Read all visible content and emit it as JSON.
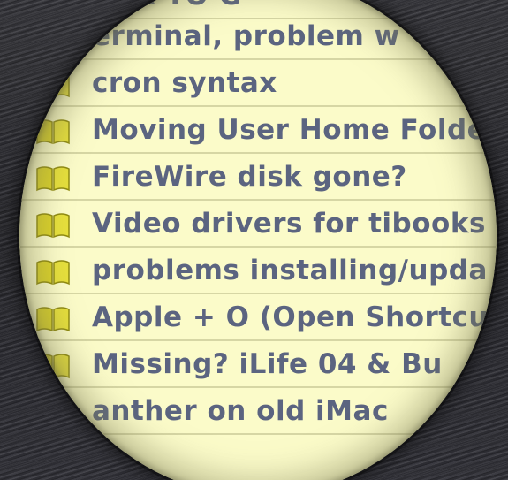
{
  "thread_list": {
    "topics": [
      {
        "title": "HER TO G",
        "icon": "book-icon"
      },
      {
        "title": "erminal, problem w",
        "icon": "book-icon"
      },
      {
        "title": "cron syntax",
        "icon": "book-icon"
      },
      {
        "title": "Moving User Home Folde",
        "icon": "book-icon"
      },
      {
        "title": "FireWire disk gone?",
        "icon": "book-icon"
      },
      {
        "title": "Video drivers for tibooks b",
        "icon": "book-icon"
      },
      {
        "title": "problems installing/upda",
        "icon": "book-icon"
      },
      {
        "title": "Apple + O (Open Shortcu",
        "icon": "book-icon"
      },
      {
        "title": "Missing? iLife 04 & Bu",
        "icon": "book-icon"
      },
      {
        "title": "anther on old iMac",
        "icon": "book-icon"
      },
      {
        "title": "",
        "icon": "book-icon"
      }
    ]
  },
  "colors": {
    "row_background": "#fbfbc9",
    "row_divider": "#d6d6a4",
    "text": "#5b6480",
    "icon_fill": "#d8d02a",
    "backdrop": "#2a2a2e"
  }
}
